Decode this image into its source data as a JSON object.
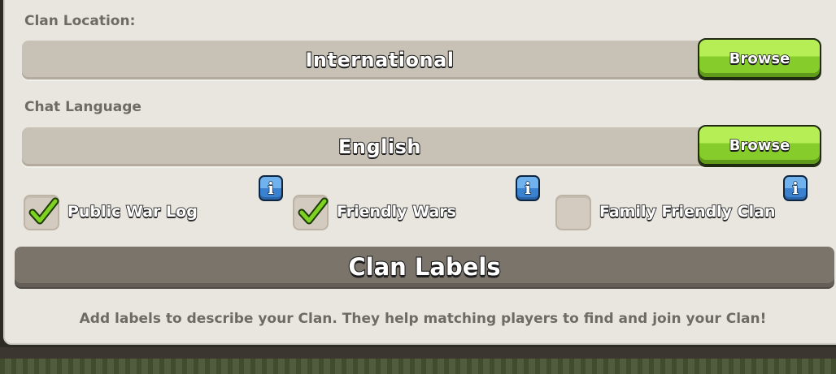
{
  "clan_location": {
    "label": "Clan Location:",
    "value": "International",
    "browse_label": "Browse"
  },
  "chat_language": {
    "label": "Chat Language",
    "value": "English",
    "browse_label": "Browse"
  },
  "options": [
    {
      "label": "Public War Log",
      "checked": true
    },
    {
      "label": "Friendly Wars",
      "checked": true
    },
    {
      "label": "Family Friendly Clan",
      "checked": false
    }
  ],
  "info_icon": "i",
  "clan_labels": {
    "title": "Clan Labels",
    "description": "Add labels to describe your Clan. They help matching players to find and join your Clan!"
  },
  "colors": {
    "panel": "#e8e6df",
    "field": "#c8c1b5",
    "browse_button": "#86cc2a",
    "info_button": "#3a82cf",
    "checkmark": "#7ed321",
    "header_bar": "#7b746b"
  }
}
